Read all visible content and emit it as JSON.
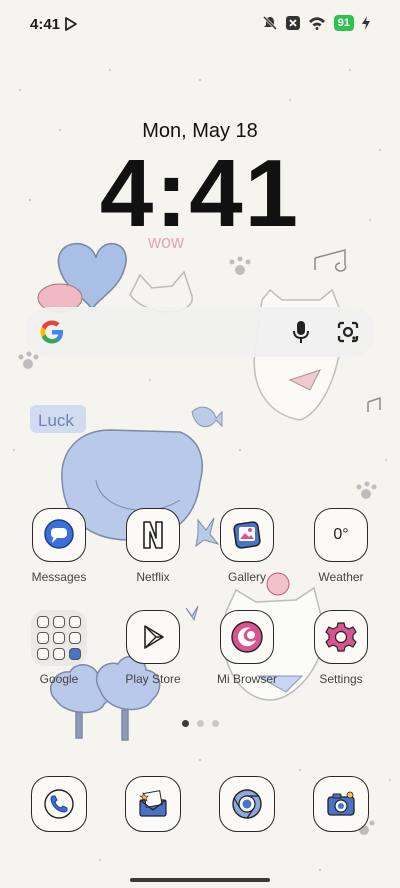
{
  "status_bar": {
    "time": "4:41",
    "battery": "91",
    "icons": [
      "play-icon",
      "mute-icon",
      "no-sim-icon",
      "wifi-icon",
      "battery-icon",
      "charging-icon"
    ]
  },
  "lockclock": {
    "date": "Mon, May 18",
    "time": "4:41"
  },
  "wallpaper_text": {
    "wow": "wow",
    "luck": "Luck"
  },
  "search": {
    "icons": [
      "google-logo",
      "mic-icon",
      "google-lens-icon"
    ]
  },
  "apps": [
    {
      "label": "Messages",
      "icon": "messages-icon"
    },
    {
      "label": "Netflix",
      "icon": "netflix-icon"
    },
    {
      "label": "Gallery",
      "icon": "gallery-icon"
    },
    {
      "label": "Weather",
      "icon": "weather-icon",
      "value": "0°"
    },
    {
      "label": "Google",
      "icon": "folder-icon"
    },
    {
      "label": "Play Store",
      "icon": "play-store-icon"
    },
    {
      "label": "Mi Browser",
      "icon": "mi-browser-icon"
    },
    {
      "label": "Settings",
      "icon": "settings-gear-icon"
    }
  ],
  "pager": {
    "pages": 3,
    "active": 1
  },
  "dock": [
    {
      "icon": "phone-icon"
    },
    {
      "icon": "mail-icon"
    },
    {
      "icon": "chrome-icon"
    },
    {
      "icon": "camera-icon"
    }
  ],
  "colors": {
    "background": "#f6f4ee",
    "accent_blue": "#a9bfe6",
    "battery_green": "#2fc24e"
  }
}
